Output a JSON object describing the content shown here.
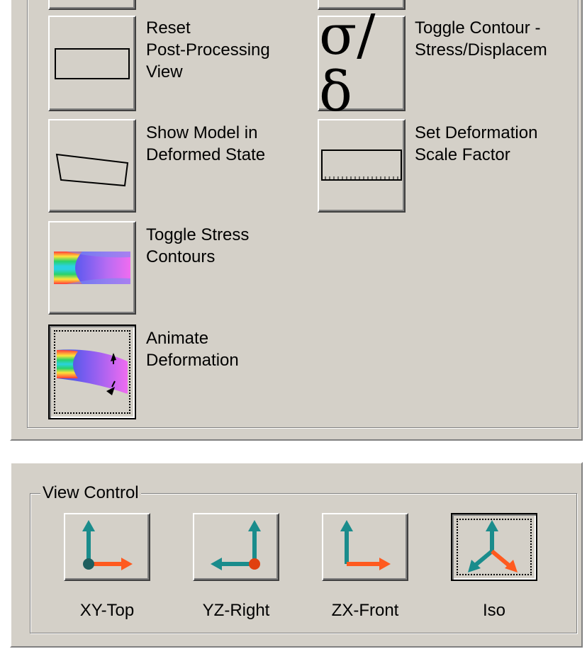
{
  "post_processing": {
    "buttons": [
      {
        "name": "reset-view-button",
        "label": "Reset\nPost-Processing\nView",
        "icon": "rectangle-icon"
      },
      {
        "name": "toggle-contour-type-button",
        "label": "Toggle Contour -\nStress/Displacem",
        "icon": "sigma-delta-icon",
        "icon_text": "σ/δ"
      },
      {
        "name": "show-deformed-button",
        "label": "Show Model in\nDeformed State",
        "icon": "deformed-shape-icon"
      },
      {
        "name": "deformation-scale-button",
        "label": "Set Deformation\nScale Factor",
        "icon": "ruler-icon"
      },
      {
        "name": "toggle-stress-contours-button",
        "label": "Toggle Stress\nContours",
        "icon": "stress-contour-icon"
      },
      {
        "name": "animate-deformation-button",
        "label": "Animate\nDeformation",
        "icon": "animate-deformation-icon",
        "pressed": true
      }
    ]
  },
  "view_control": {
    "title": "View Control",
    "buttons": [
      {
        "name": "view-xy-top-button",
        "label": "XY-Top",
        "icon": "xy-axes-icon"
      },
      {
        "name": "view-yz-right-button",
        "label": "YZ-Right",
        "icon": "yz-axes-icon"
      },
      {
        "name": "view-zx-front-button",
        "label": "ZX-Front",
        "icon": "zx-axes-icon"
      },
      {
        "name": "view-iso-button",
        "label": "Iso",
        "icon": "iso-axes-icon",
        "pressed": true
      }
    ]
  },
  "colors": {
    "face": "#d4d0c8",
    "axis_teal": "#1a8c8c",
    "axis_orange": "#ff5a1f",
    "axis_origin_dark": "#1f5f5f"
  }
}
